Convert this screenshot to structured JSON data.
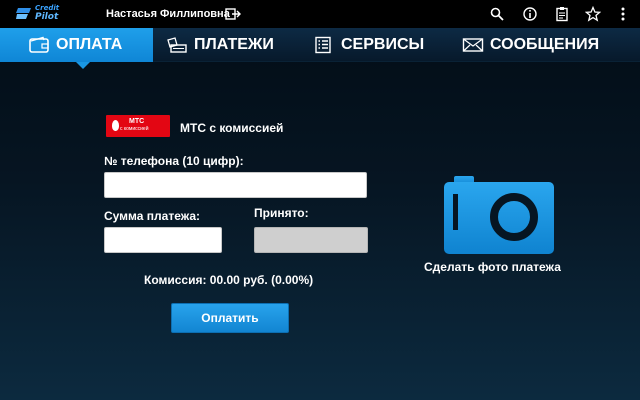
{
  "app": {
    "brand_line1": "Credit",
    "brand_line2": "Pilot",
    "user_name": "Настасья Филлиповна"
  },
  "topbar_icons": [
    "search-icon",
    "info-icon",
    "clipboard-icon",
    "star-icon",
    "more-vert-icon"
  ],
  "tabs": [
    {
      "label": "ОПЛАТА",
      "icon": "wallet-icon",
      "active": true
    },
    {
      "label": "ПЛАТЕЖИ",
      "icon": "payments-icon",
      "active": false
    },
    {
      "label": "СЕРВИСЫ",
      "icon": "list-icon",
      "active": false
    },
    {
      "label": "СООБЩЕНИЯ",
      "icon": "envelope-icon",
      "active": false
    }
  ],
  "operator": {
    "logo_title": "МТС",
    "logo_subtitle": "с комиссией",
    "name": "МТС с комиссией"
  },
  "form": {
    "phone_label": "№ телефона (10 цифр):",
    "phone_value": "",
    "amount_label": "Сумма платежа:",
    "amount_value": "",
    "accepted_label": "Принято:",
    "accepted_value": "",
    "commission_text": "Комиссия: 00.00 руб. (0.00%)",
    "pay_button": "Оплатить"
  },
  "photo": {
    "caption": "Сделать фото платежа"
  },
  "colors": {
    "accent": "#1a97e4",
    "operator_red": "#e30613",
    "background_dark": "#061522"
  }
}
